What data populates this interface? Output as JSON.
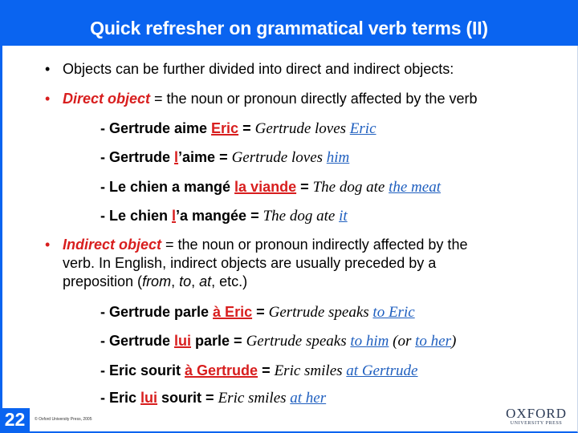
{
  "header": {
    "title": "Quick refresher on grammatical verb terms (II)"
  },
  "bullets": [
    {
      "marker": "•",
      "text": "Objects can be further divided into direct and indirect objects:"
    },
    {
      "marker": "•",
      "term": "Direct object",
      "text": " = the noun or pronoun directly affected by the verb"
    },
    {
      "marker": "•",
      "term": "Indirect object",
      "text_line1": " = the noun or pronoun indirectly affected by the",
      "text_line2": "verb. In English, indirect objects are usually preceded by a",
      "text_line3_pre": "preposition (",
      "prep_from": "from",
      "comma1": ", ",
      "prep_to": "to",
      "comma2": ", ",
      "prep_at": "at",
      "text_line3_post": ", etc.)"
    }
  ],
  "direct_examples": [
    {
      "fr_pre": "- Gertrude aime ",
      "fr_hl": "Eric",
      "fr_post": "",
      "eq": " = ",
      "en_pre": "Gertrude loves ",
      "en_hl": "Eric",
      "en_post": ""
    },
    {
      "fr_pre": "- Gertrude ",
      "fr_hl": "l",
      "fr_post": "’aime",
      "eq": " = ",
      "en_pre": "Gertrude loves ",
      "en_hl": "him",
      "en_post": ""
    },
    {
      "fr_pre": "- Le chien a mangé ",
      "fr_hl": "la viande",
      "fr_post": "",
      "eq": " = ",
      "en_pre": "The dog ate ",
      "en_hl": "the meat",
      "en_post": ""
    },
    {
      "fr_pre": "- Le chien ",
      "fr_hl": "l",
      "fr_post": "’a mangée",
      "eq": " = ",
      "en_pre": "The dog ate ",
      "en_hl": "it",
      "en_post": ""
    }
  ],
  "indirect_examples": [
    {
      "fr_pre": "- Gertrude parle ",
      "fr_hl": "à Eric",
      "fr_post": "",
      "eq": " = ",
      "en_pre": "Gertrude speaks ",
      "en_hl": "to Eric",
      "en_mid": "",
      "en_hl2": "",
      "en_post": ""
    },
    {
      "fr_pre": "- Gertrude ",
      "fr_hl": "lui",
      "fr_post": " parle",
      "eq": " = ",
      "en_pre": "Gertrude speaks ",
      "en_hl": "to him",
      "en_mid": " (or ",
      "en_hl2": "to her",
      "en_post": ")"
    },
    {
      "fr_pre": "- Eric sourit ",
      "fr_hl": "à Gertrude",
      "fr_post": "",
      "eq": " = ",
      "en_pre": "Eric smiles ",
      "en_hl": "at Gertrude",
      "en_mid": "",
      "en_hl2": "",
      "en_post": ""
    },
    {
      "fr_pre": "- Eric ",
      "fr_hl": "lui",
      "fr_post": " sourit",
      "eq": " = ",
      "en_pre": "Eric smiles ",
      "en_hl": "at her",
      "en_mid": "",
      "en_hl2": "",
      "en_post": ""
    }
  ],
  "footer": {
    "page_number": "22",
    "copyright": "© Oxford University Press, 2005",
    "logo_main": "OXFORD",
    "logo_sub": "UNIVERSITY PRESS"
  },
  "colors": {
    "header_blue": "#0a64f0",
    "term_red": "#d81e1e",
    "translation_blue": "#1f5fbf"
  }
}
